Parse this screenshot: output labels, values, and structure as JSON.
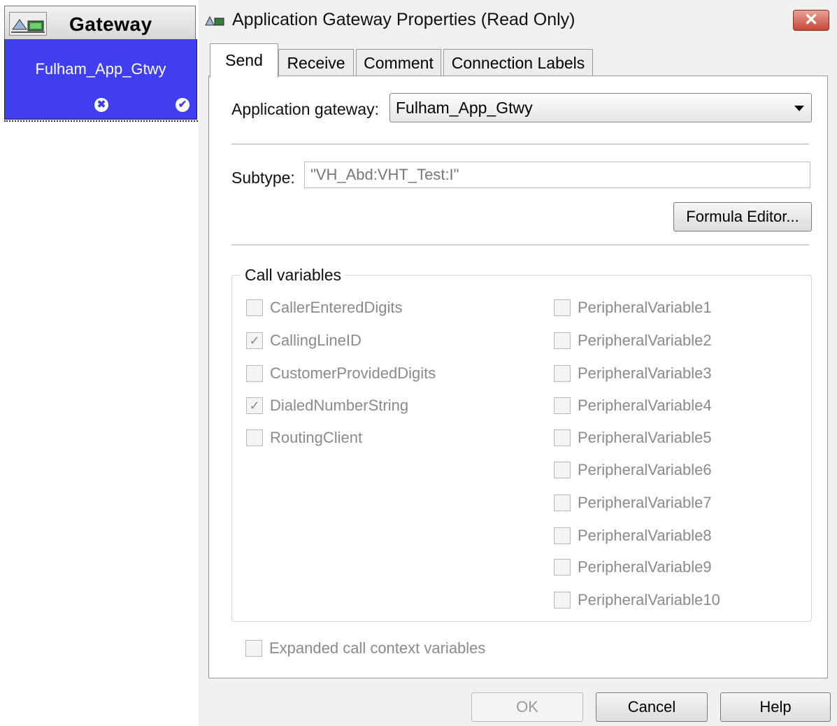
{
  "node": {
    "title": "Gateway",
    "name": "Fulham_App_Gtwy",
    "icon": "gateway-icon",
    "failure_glyph": "✖",
    "success_glyph": "✔",
    "color": "#3f3ff0"
  },
  "dialog": {
    "title": "Application Gateway Properties (Read Only)",
    "close_glyph": "✕",
    "close_color": "#c6483a"
  },
  "tabs": [
    {
      "label": "Send",
      "active": true
    },
    {
      "label": "Receive",
      "active": false
    },
    {
      "label": "Comment",
      "active": false
    },
    {
      "label": "Connection Labels",
      "active": false
    }
  ],
  "send": {
    "gateway_label": "Application gateway:",
    "gateway_value": "Fulham_App_Gtwy",
    "subtype_label": "Subtype:",
    "subtype_value": "\"VH_Abd:VHT_Test:I\"",
    "formula_button": "Formula Editor...",
    "call_variables_title": "Call variables",
    "left_vars": [
      {
        "label": "CallerEnteredDigits",
        "checked": false
      },
      {
        "label": "CallingLineID",
        "checked": true
      },
      {
        "label": "CustomerProvidedDigits",
        "checked": false
      },
      {
        "label": "DialedNumberString",
        "checked": true
      },
      {
        "label": "RoutingClient",
        "checked": false
      }
    ],
    "right_vars": [
      {
        "label": "PeripheralVariable1",
        "checked": false
      },
      {
        "label": "PeripheralVariable2",
        "checked": false
      },
      {
        "label": "PeripheralVariable3",
        "checked": false
      },
      {
        "label": "PeripheralVariable4",
        "checked": false
      },
      {
        "label": "PeripheralVariable5",
        "checked": false
      },
      {
        "label": "PeripheralVariable6",
        "checked": false
      },
      {
        "label": "PeripheralVariable7",
        "checked": false
      },
      {
        "label": "PeripheralVariable8",
        "checked": false
      },
      {
        "label": "PeripheralVariable9",
        "checked": false
      },
      {
        "label": "PeripheralVariable10",
        "checked": false
      }
    ],
    "expanded_label": "Expanded call context variables",
    "expanded_checked": false
  },
  "buttons": {
    "ok": "OK",
    "cancel": "Cancel",
    "help": "Help"
  }
}
